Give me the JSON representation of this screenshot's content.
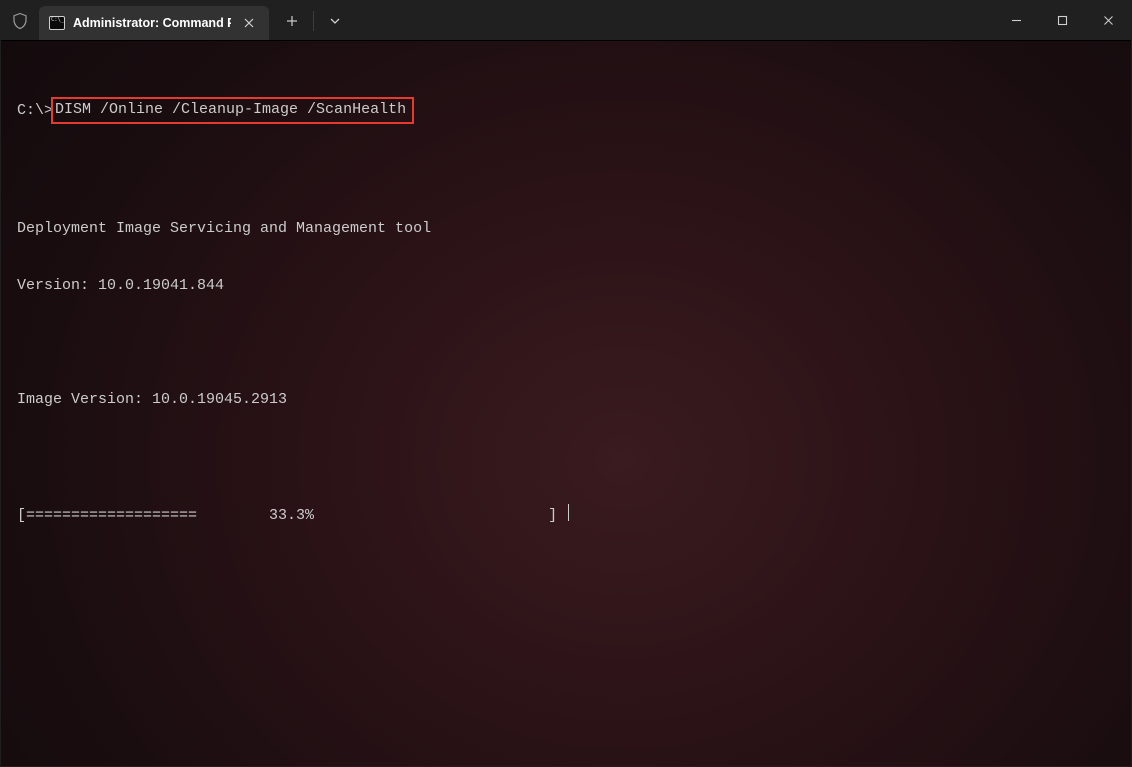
{
  "window": {
    "tab_title": "Administrator: Command Prom"
  },
  "terminal": {
    "prompt": "C:\\>",
    "command": "DISM /Online /Cleanup-Image /ScanHealth",
    "line_tool": "Deployment Image Servicing and Management tool",
    "line_version": "Version: 10.0.19041.844",
    "line_image_version": "Image Version: 10.0.19045.2913",
    "progress_line": "[===================        33.3%                          ] "
  },
  "colors": {
    "highlight_border": "#e53a2f",
    "tab_bg": "#323232",
    "titlebar_bg": "#202020",
    "text": "#cccccc"
  }
}
